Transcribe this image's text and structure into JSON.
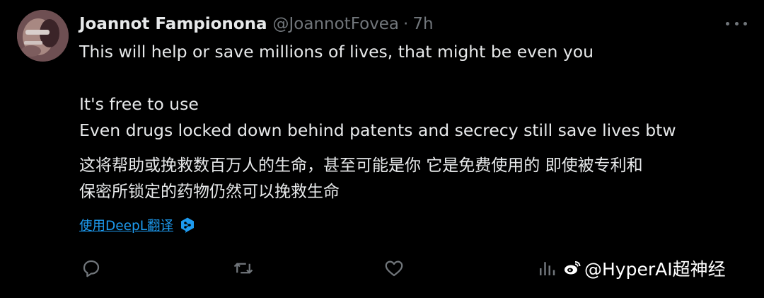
{
  "author": {
    "display_name": "Joannot Fampionona",
    "handle": "@JoannotFovea",
    "separator": "·",
    "time": "7h"
  },
  "tweet": {
    "lines": [
      "This will help or save millions of lives, that might be even you",
      "",
      "It's free to use",
      "Even drugs locked down behind patents and secrecy still save lives btw"
    ],
    "translation_lines": [
      "这将帮助或挽救数百万人的生命，甚至可能是你 它是免费使用的 即使被专利和",
      "保密所锁定的药物仍然可以挽救生命"
    ],
    "translate_label": "使用DeepL翻译"
  },
  "actions": {
    "icons": [
      "reply-icon",
      "retweet-icon",
      "like-icon",
      "views-icon"
    ]
  },
  "watermark": {
    "text": "@HyperAI超神经"
  },
  "colors": {
    "background": "#000000",
    "text_primary": "#e7e9ea",
    "text_secondary": "#71767b",
    "link": "#1d9bf0"
  }
}
